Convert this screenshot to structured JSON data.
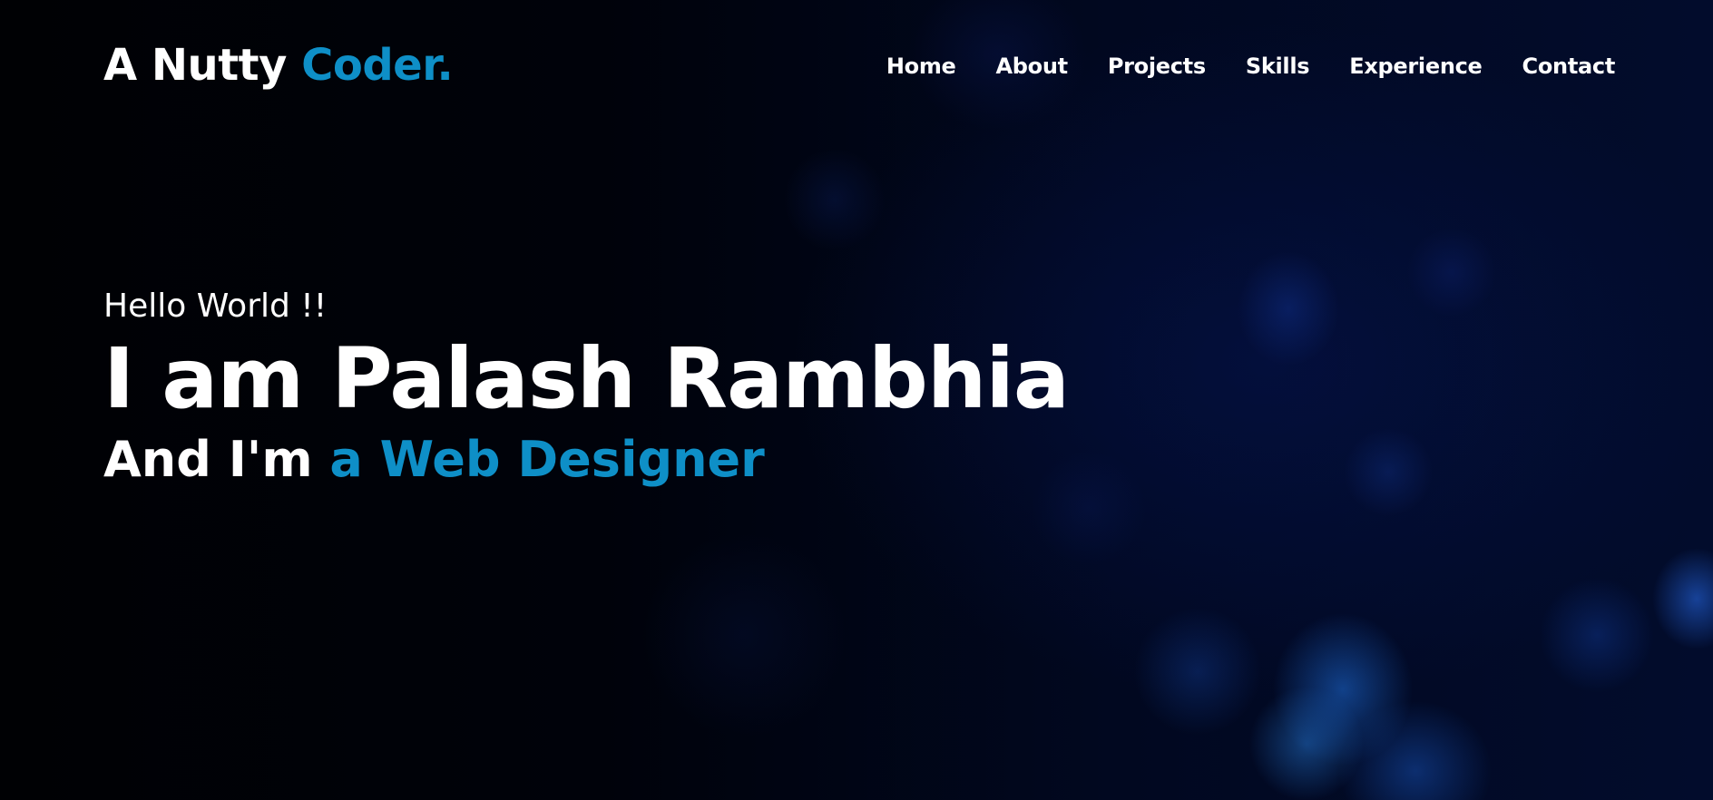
{
  "brand": {
    "name_prefix": "A Nutty",
    "name_accent": "Coder.",
    "accent_color": "#0e8fc7"
  },
  "nav": {
    "items": [
      {
        "label": "Home"
      },
      {
        "label": "About"
      },
      {
        "label": "Projects"
      },
      {
        "label": "Skills"
      },
      {
        "label": "Experience"
      },
      {
        "label": "Contact"
      }
    ]
  },
  "hero": {
    "greeting": "Hello World !!",
    "headline": "I am Palash Rambhia",
    "role_prefix": "And I'm",
    "role_accent": "a Web Designer"
  },
  "colors": {
    "background": "#000105",
    "text": "#ffffff",
    "accent": "#0e8fc7",
    "bokeh": "#1e6edc"
  }
}
